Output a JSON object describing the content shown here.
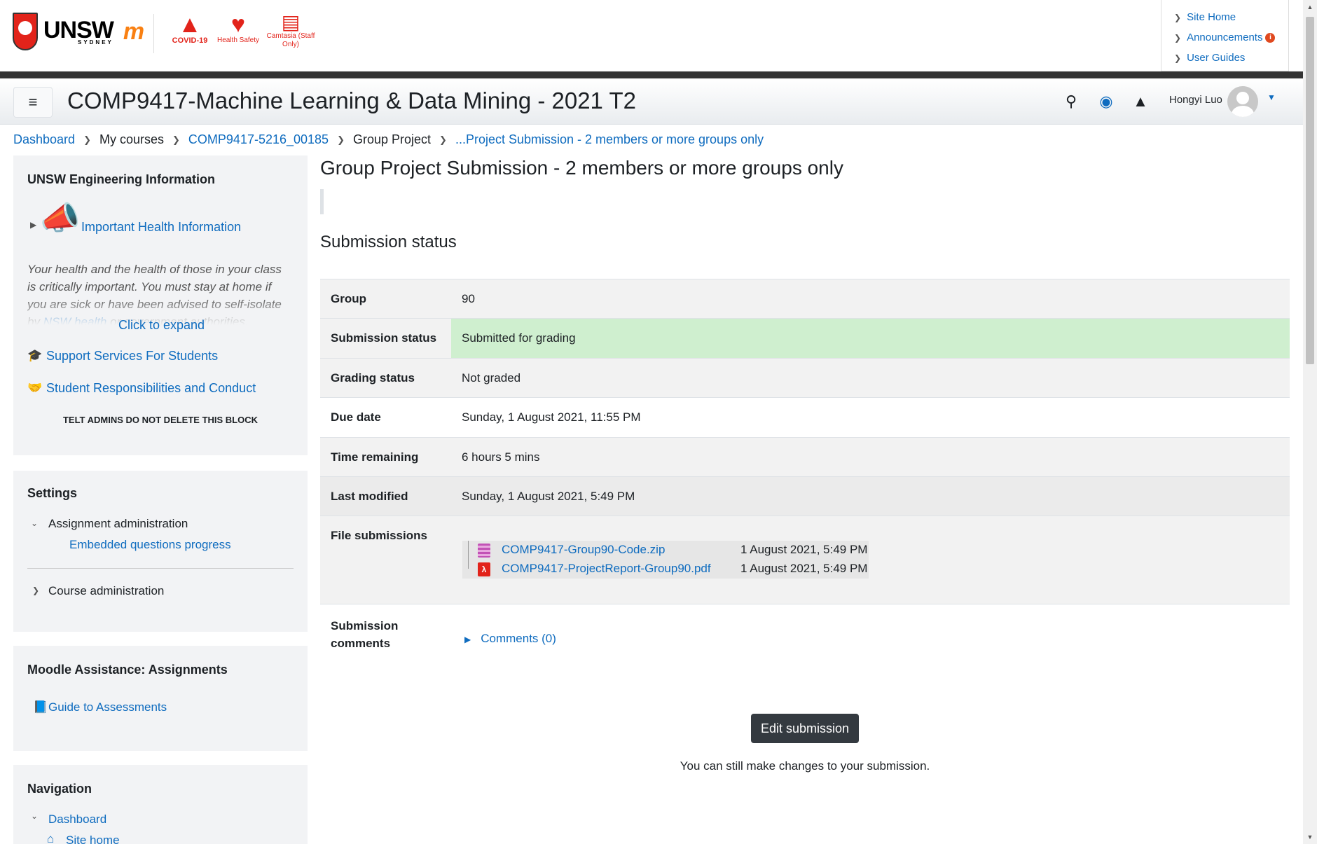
{
  "header": {
    "unsw_logo_text": "UNSW",
    "unsw_logo_sub": "SYDNEY",
    "quick_links": [
      {
        "label": "COVID-19",
        "icon": "warning-triangle-icon"
      },
      {
        "label": "Health Safety",
        "icon": "heart-icon"
      },
      {
        "label": "Camtasia (Staff Only)",
        "icon": "video-file-icon"
      }
    ],
    "site_links": [
      "Site Home",
      "Announcements",
      "User Guides"
    ],
    "announcement_badge": "i"
  },
  "navbar": {
    "course_title": "COMP9417-Machine Learning & Data Mining - 2021 T2",
    "user_name": "Hongyi Luo"
  },
  "breadcrumb": {
    "items": [
      "Dashboard",
      "My courses",
      "COMP9417-5216_00185",
      "Group Project",
      "...Project Submission - 2 members or more groups only"
    ]
  },
  "sidebar": {
    "engineering": {
      "title": "UNSW Engineering Information",
      "health_link": "Important Health Information",
      "health_text_1": "Your health and the health of those in your class",
      "health_text_2": "is critically important. You must stay at home if",
      "health_text_3": "you are sick or have been advised to self-isolate",
      "health_text_4a": "by ",
      "health_text_4_link": "NSW health",
      "health_text_4b": " or government authorities.",
      "expand": "Click to expand",
      "support_link": "Support Services For Students",
      "conduct_link": "Student Responsibilities and Conduct",
      "admin_note": "TELT ADMINS DO NOT DELETE THIS BLOCK"
    },
    "settings": {
      "title": "Settings",
      "assignment_admin": "Assignment administration",
      "embedded_progress": "Embedded questions progress",
      "course_admin": "Course administration"
    },
    "moodle_assist": {
      "title": "Moodle Assistance: Assignments",
      "guide_link": "Guide to Assessments"
    },
    "navigation": {
      "title": "Navigation",
      "dashboard": "Dashboard",
      "site_home": "Site home"
    }
  },
  "main": {
    "page_title": "Group Project Submission - 2 members or more groups only",
    "section_title": "Submission status",
    "rows": [
      {
        "label": "Group",
        "value": "90"
      },
      {
        "label": "Submission status",
        "value": "Submitted for grading"
      },
      {
        "label": "Grading status",
        "value": "Not graded"
      },
      {
        "label": "Due date",
        "value": "Sunday, 1 August 2021, 11:55 PM"
      },
      {
        "label": "Time remaining",
        "value": "6 hours 5 mins"
      },
      {
        "label": "Last modified",
        "value": "Sunday, 1 August 2021, 5:49 PM"
      },
      {
        "label": "File submissions",
        "value": ""
      },
      {
        "label_1": "Submission",
        "label_2": "comments",
        "value": ""
      }
    ],
    "files": [
      {
        "name": "COMP9417-Group90-Code.zip",
        "date": "1 August 2021, 5:49 PM",
        "type": "zip"
      },
      {
        "name": "COMP9417-ProjectReport-Group90.pdf",
        "date": "1 August 2021, 5:49 PM",
        "type": "pdf"
      }
    ],
    "comments_link": "Comments (0)",
    "edit_button": "Edit submission",
    "edit_note": "You can still make changes to your submission."
  },
  "colors": {
    "link": "#0f6cbf",
    "submitted_bg": "#cfefcf",
    "covid_red": "#e2231a",
    "edit_button_bg": "#343a40"
  }
}
